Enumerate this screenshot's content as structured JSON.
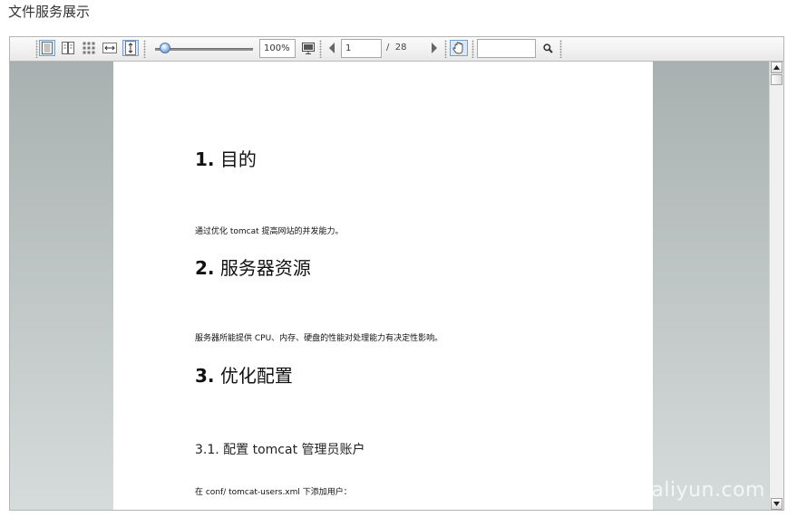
{
  "page": {
    "title": "文件服务展示"
  },
  "toolbar": {
    "zoom_value": "100%",
    "page_current": "1",
    "page_total": "/  28",
    "search_value": "",
    "zoom_level": 1.0
  },
  "document": {
    "sections": [
      {
        "num": "1.",
        "title": "目的"
      },
      {
        "num": "2.",
        "title": "服务器资源"
      },
      {
        "num": "3.",
        "title": "优化配置"
      }
    ],
    "para_1": "通过优化 tomcat 提高网站的并发能力。",
    "para_2": "服务器所能提供 CPU、内存、硬盘的性能对处理能力有决定性影响。",
    "subsection": "3.1. 配置 tomcat 管理员账户",
    "para_3": "在 conf/ tomcat-users.xml 下添加用户："
  },
  "watermark": "云栖社区 yq.aliyun.com",
  "colors": {
    "accent": "#7aa0c8",
    "viewer_bg": "#c9d0cf"
  }
}
